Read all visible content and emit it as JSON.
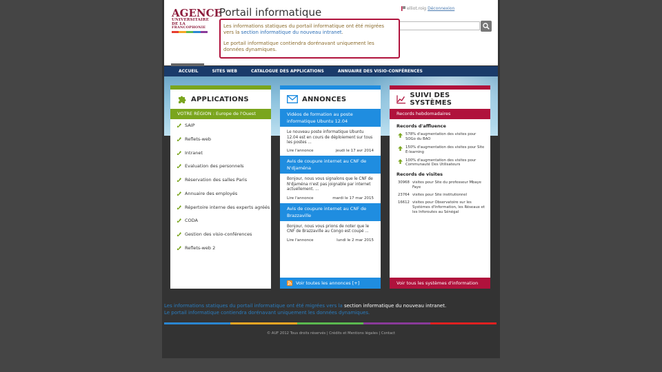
{
  "logo": {
    "line1": "AGENCE",
    "line2": "UNIVERSITAIRE",
    "line3": "DE LA",
    "line4": "FRANCOPHONIE",
    "bar_colors": [
      "#e63b2e",
      "#f5a623",
      "#5ab94f",
      "#2a86d1",
      "#8a3a9a"
    ]
  },
  "header": {
    "title": "Portail informatique",
    "username": "elliot.roig",
    "logout": "Déconnexion",
    "search_placeholder": ""
  },
  "notice": {
    "line1_pre": "Les informations statiques du portail informatique ont été migrées vers la ",
    "line1_link": "section informatique du nouveau intranet",
    "line1_post": ".",
    "line2": "Le portail informatique contiendra dorénavant uniquement les données dynamiques."
  },
  "nav": {
    "items": [
      "ACCUEIL",
      "SITES WEB",
      "CATALOGUE DES APPLICATIONS",
      "ANNUAIRE DES VISIO-CONFÉRENCES"
    ]
  },
  "applications": {
    "title": "APPLICATIONS",
    "region": "VOTRE RÉGION : Europe de l'Ouest",
    "items": [
      "SAIP",
      "Reflets-web",
      "Intranet",
      "Evaluation des personnels",
      "Réservation des salles Paris",
      "Annuaire des employés",
      "Répertoire interne des experts agréés",
      "CODA",
      "Gestion des visio-conférences",
      "Reflets-web 2"
    ]
  },
  "annonces": {
    "title": "ANNONCES",
    "items": [
      {
        "title": "Vidéos de formation au poste informatique Ubuntu 12.04",
        "body": "Le nouveau poste informatique Ubuntu 12.04 est en cours de déploiement sur tous les postes ...",
        "more": "Lire l'annonce",
        "date": "jeudi le 17 avr 2014"
      },
      {
        "title": "Avis de coupure internet au CNF de N'djaména",
        "body": "Bonjour, nous vous signalons que le CNF de N'djaména n'est pas joignable par internet actuellement. ...",
        "more": "Lire l'annonce",
        "date": "mardi le 17 mar 2015"
      },
      {
        "title": "Avis de coupure internet au CNF de Brazzaville",
        "body": "Bonjour, nous vous prions de noter que le CNF de Brazzaville au Congo est coupé ...",
        "more": "Lire l'annonce",
        "date": "lundi le 2 mar 2015"
      }
    ],
    "footer": "Voir toutes les annonces [+]"
  },
  "systemes": {
    "title": "SUIVI DES SYSTÈMES",
    "sub": "Records hebdomadaires",
    "affluence_title": "Records d'affluence",
    "affluence": [
      "578% d'augmentation des visites pour SOGo du BAO",
      "150% d'augmentation des visites pour Site E-learning",
      "100% d'augmentation des visites pour Communauté Des Utilisateurs"
    ],
    "visites_title": "Records de visites",
    "visites": [
      {
        "n": "30968",
        "t": "visites pour Site du professeur Mbaye Faye"
      },
      {
        "n": "23764",
        "t": "visites pour Site institutionnel"
      },
      {
        "n": "16612",
        "t": "visites pour Observatoire sur les Systèmes d'Information, les Réseaux et les Inforoutes au Sénégal"
      }
    ],
    "footer": "Voir tous les systèmes d'information"
  },
  "footer": {
    "note1_pre": "Les informations statiques du portail informatique ont été migrées vers la ",
    "note1_link": "section informatique du nouveau intranet",
    "note1_post": ".",
    "note2": "Le portail informatique contiendra dorénavant uniquement les données dynamiques.",
    "copyright": "© AUF 2012 Tous droits réservés | Crédits et Mentions légales | Contact",
    "bar_colors": [
      "#2a86d1",
      "#f5a623",
      "#5ab94f",
      "#8a3a9a",
      "#e02020"
    ]
  },
  "colors": {
    "green": "#7aa51d",
    "blue": "#1f8de0",
    "crimson": "#b0123c",
    "navy": "#1a3b6a"
  }
}
